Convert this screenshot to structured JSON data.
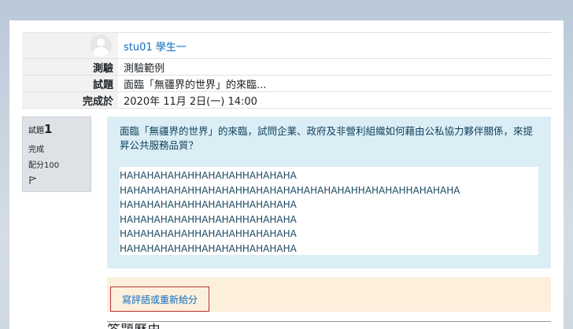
{
  "summary": {
    "user_name": "stu01 學生一",
    "rows": [
      {
        "label": "測驗",
        "value": "測驗範例"
      },
      {
        "label": "試題",
        "value": "面臨「無疆界的世界」的來臨..."
      },
      {
        "label": "完成於",
        "value": "2020年 11月 2日(一) 14:00"
      }
    ]
  },
  "question_info": {
    "label": "試題",
    "number": "1",
    "state": "完成",
    "marks": "配分100",
    "flag_icon": "flag-icon"
  },
  "question": {
    "text": "面臨「無疆界的世界」的來臨，試問企業、政府及非營利組織如何藉由公私協力夥伴關係，來提昇公共服務品質？",
    "answer_lines": [
      "HAHAHAHAHAHHAHAHAHHAHAHAHA",
      "HAHAHAHAHAHHAHAHAHHAHAHAHAHAHAHAHAHHAHAHAHHAHAHAHA",
      "HAHAHAHAHAHHAHAHAHHAHAHAHA",
      "HAHAHAHAHAHHAHAHAHHAHAHAHA",
      "HAHAHAHAHAHHAHAHAHHAHAHAHA",
      "HAHAHAHAHAHHAHAHAHHAHAHAHA"
    ]
  },
  "comment": {
    "button_label": "寫評語或重新給分"
  },
  "history": {
    "title": "答題歷史"
  }
}
